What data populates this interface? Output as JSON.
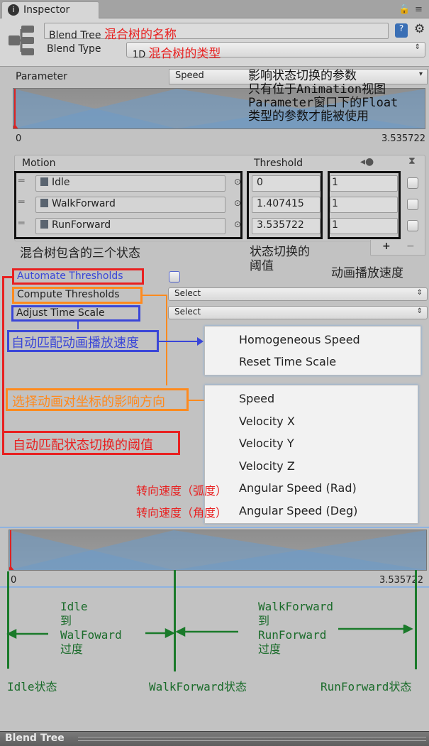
{
  "tab": {
    "title": "Inspector",
    "lock_icon": "lock-icon",
    "menu_icon": "menu-icon"
  },
  "header": {
    "name_value": "Blend Tree",
    "name_note": "混合树的名称",
    "blend_type_label": "Blend Type",
    "blend_type_value": "1D",
    "blend_type_note": "混合树的类型"
  },
  "parameter": {
    "label": "Parameter",
    "value": "Speed",
    "note": [
      "影响状态切换的参数",
      "只有位于Animation视图",
      "Parameter窗口下的Float",
      "类型的参数才能被使用"
    ],
    "min": "0",
    "max": "3.535722"
  },
  "table": {
    "headers": {
      "motion": "Motion",
      "threshold": "Threshold"
    },
    "rows": [
      {
        "motion": "Idle",
        "threshold": "0",
        "speed": "1"
      },
      {
        "motion": "WalkForward",
        "threshold": "1.407415",
        "speed": "1"
      },
      {
        "motion": "RunForward",
        "threshold": "3.535722",
        "speed": "1"
      }
    ],
    "add": "+",
    "remove": "−",
    "notes": {
      "motions": "混合树包含的三个状态",
      "threshold_line1": "状态切换的",
      "threshold_line2": "阈值",
      "speed": "动画播放速度"
    }
  },
  "options": {
    "automate": "Automate Thresholds",
    "compute": "Compute Thresholds",
    "compute_value": "Select",
    "adjust": "Adjust Time Scale",
    "adjust_value": "Select"
  },
  "annotations": {
    "adjust": "自动匹配动画播放速度",
    "compute": "选择动画对坐标的影响方向",
    "automate": "自动匹配状态切换的阈值",
    "rad": "转向速度（弧度）",
    "deg": "转向速度（角度）"
  },
  "adjust_menu": [
    "Homogeneous Speed",
    "Reset Time Scale"
  ],
  "compute_menu": [
    "Speed",
    "Velocity X",
    "Velocity Y",
    "Velocity Z",
    "Angular Speed (Rad)",
    "Angular Speed (Deg)"
  ],
  "graph2": {
    "min": "0",
    "max": "3.535722"
  },
  "transitions": {
    "first": [
      "Idle",
      "到",
      "WalFoward",
      "过度"
    ],
    "second": [
      "WalkForward",
      "到",
      "RunForward",
      "过度"
    ],
    "states": [
      "Idle状态",
      "WalkForward状态",
      "RunForward状态"
    ]
  },
  "footer": {
    "title": "Blend Tree"
  },
  "colors": {
    "annot_red": "#e82020",
    "annot_blue": "#3a46d8",
    "annot_orange": "#ff8a1e",
    "annot_green": "#1a7a2a"
  }
}
